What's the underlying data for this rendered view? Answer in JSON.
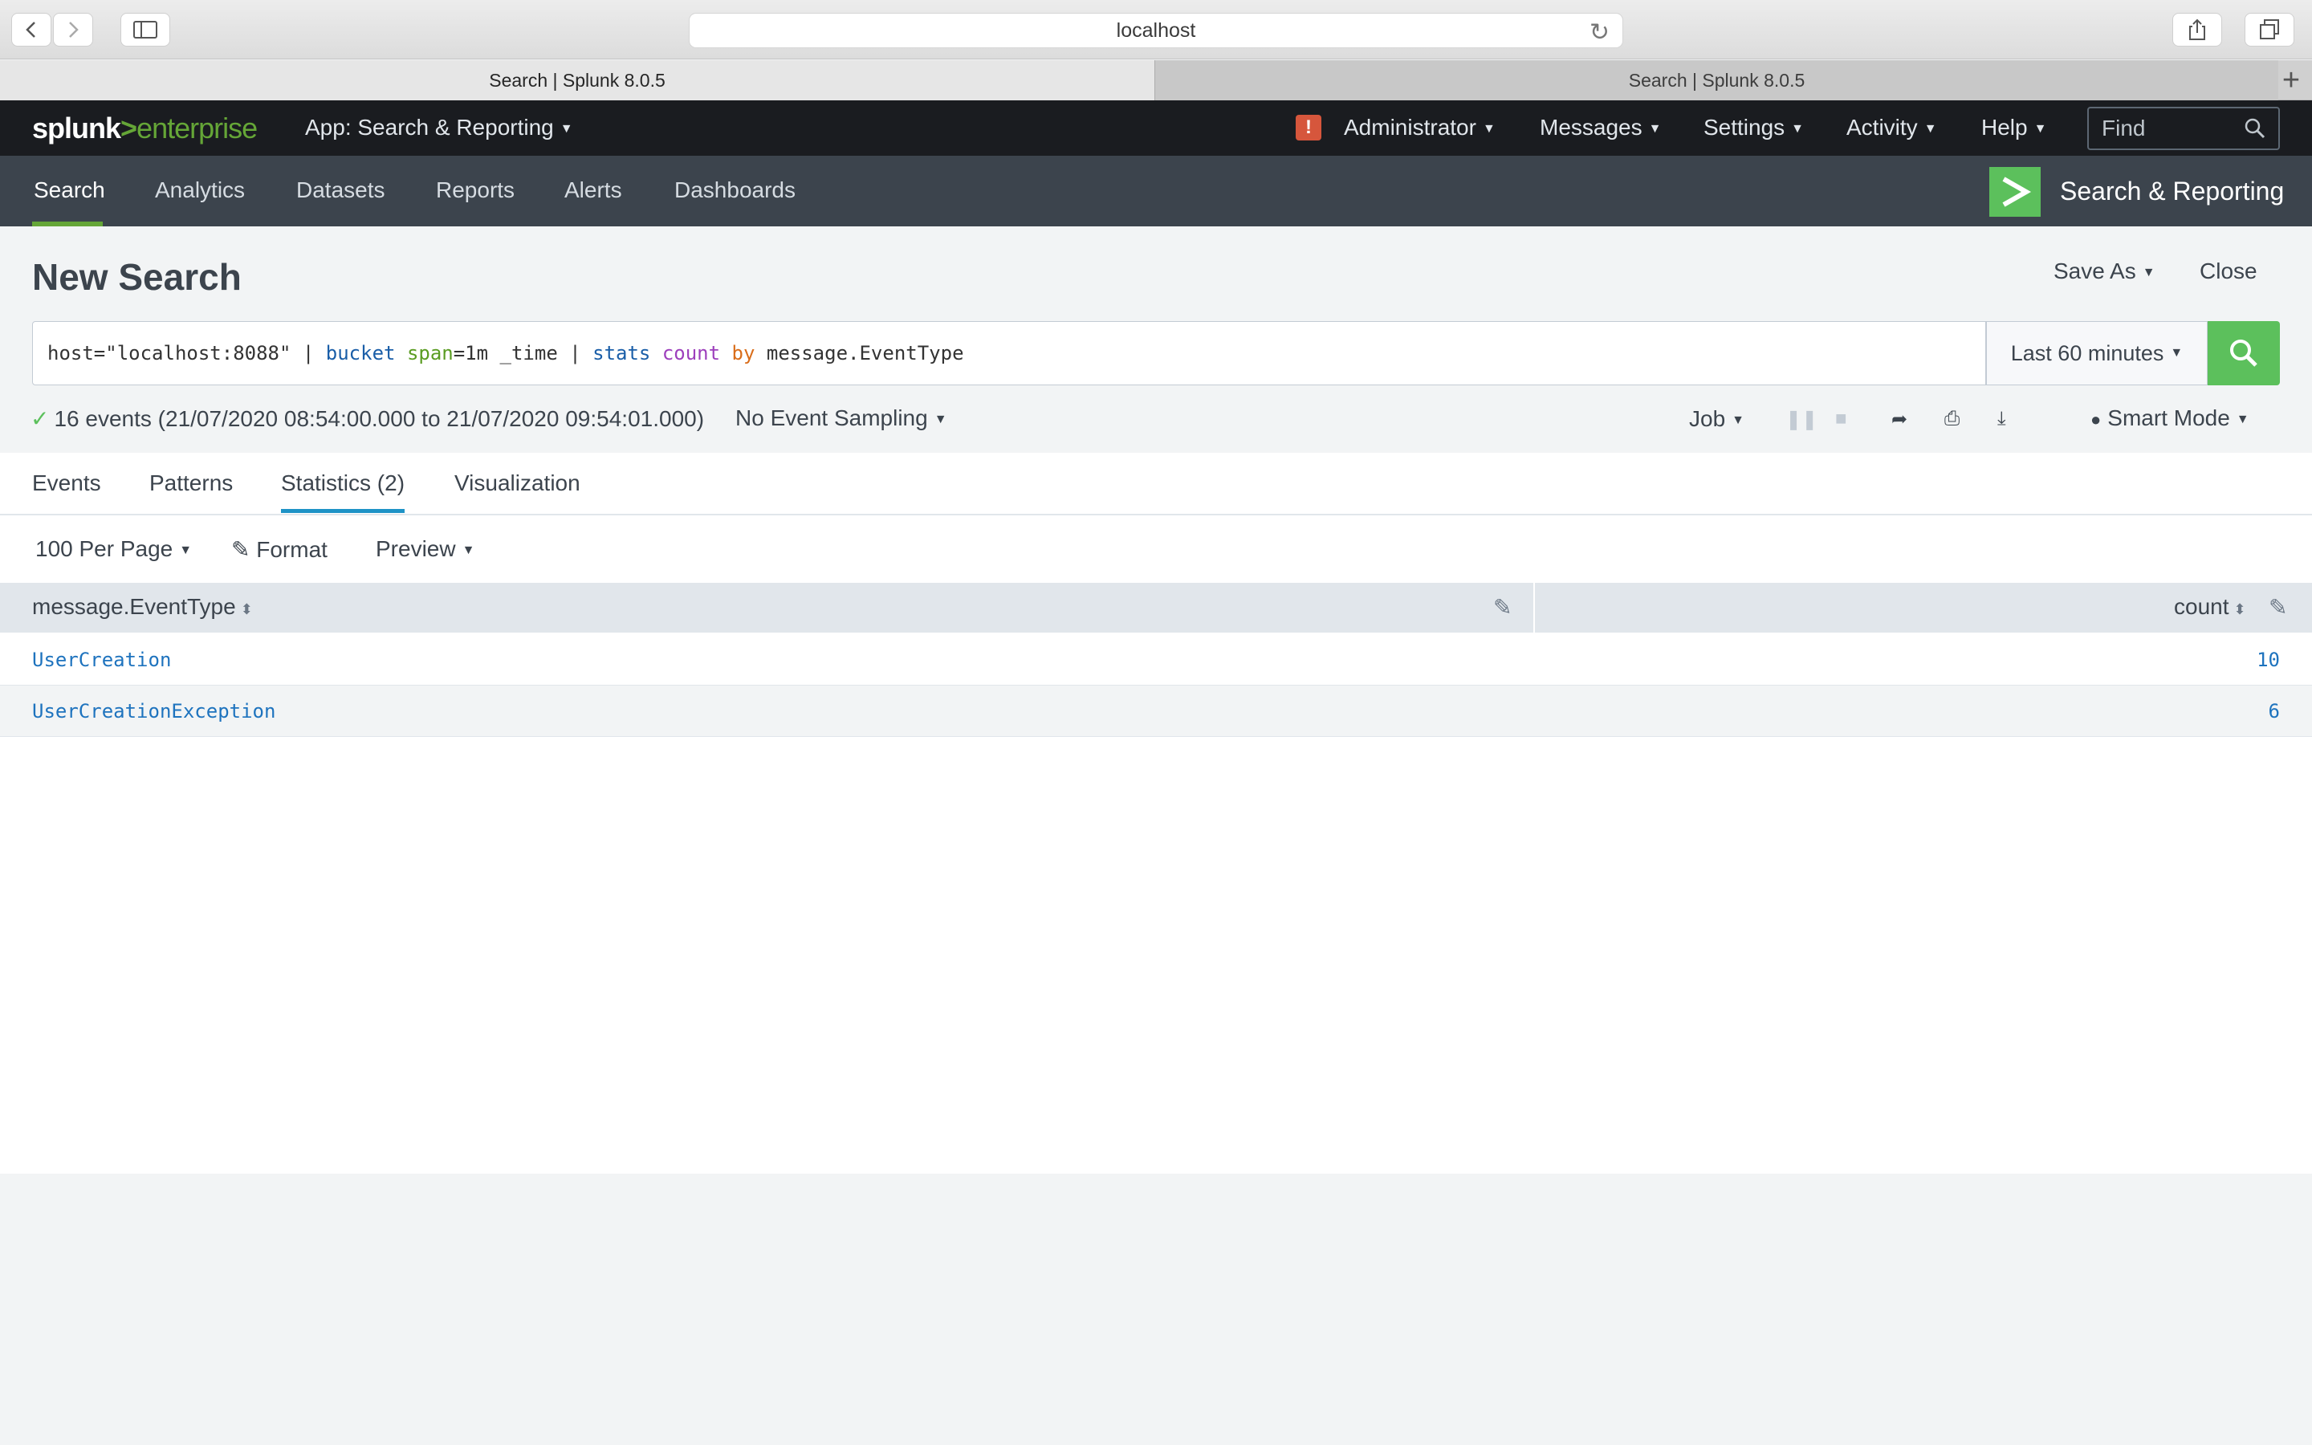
{
  "browser": {
    "url": "localhost",
    "tabs": [
      {
        "title": "Search | Splunk 8.0.5",
        "active": true
      },
      {
        "title": "Search | Splunk 8.0.5",
        "active": false
      }
    ],
    "new_tab": "+"
  },
  "topbar": {
    "logo": {
      "a": "splunk",
      "b": ">",
      "c": "enterprise"
    },
    "app_menu": "App: Search & Reporting",
    "alert_badge": "!",
    "menus": [
      "Administrator",
      "Messages",
      "Settings",
      "Activity",
      "Help"
    ],
    "find_placeholder": "Find"
  },
  "appbar": {
    "nav": [
      "Search",
      "Analytics",
      "Datasets",
      "Reports",
      "Alerts",
      "Dashboards"
    ],
    "active": "Search",
    "app_title": "Search & Reporting"
  },
  "page": {
    "title": "New Search",
    "save_as": "Save As",
    "close": "Close"
  },
  "search": {
    "query_parts": {
      "p1": "host=\"localhost:8088\" | ",
      "p2": "bucket",
      "p3": " ",
      "p4": "span",
      "p5": "=1m _time | ",
      "p6": "stats",
      "p7": " ",
      "p8": "count",
      "p9": " ",
      "p10": "by",
      "p11": " message.EventType"
    },
    "time_range": "Last 60 minutes"
  },
  "status": {
    "summary": "16 events (21/07/2020 08:54:00.000 to 21/07/2020 09:54:01.000)",
    "sampling": "No Event Sampling",
    "job": "Job",
    "mode": "Smart Mode"
  },
  "result_tabs": [
    "Events",
    "Patterns",
    "Statistics (2)",
    "Visualization"
  ],
  "active_result_tab": "Statistics (2)",
  "options": {
    "per_page": "100 Per Page",
    "format": "Format",
    "preview": "Preview"
  },
  "table": {
    "columns": [
      "message.EventType",
      "count"
    ],
    "rows": [
      [
        "UserCreation",
        "10"
      ],
      [
        "UserCreationException",
        "6"
      ]
    ]
  },
  "colors": {
    "accent_green": "#5cc05c",
    "splunk_green": "#65a637",
    "link_blue": "#1e73be",
    "topbar": "#1a1c20",
    "appbar": "#3c444d"
  }
}
